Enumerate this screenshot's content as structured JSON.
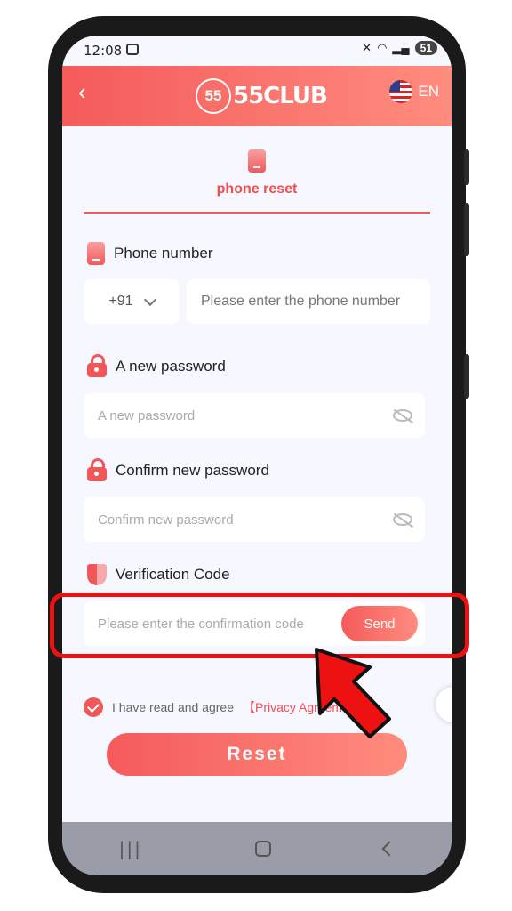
{
  "status": {
    "time": "12:08",
    "battery": "51"
  },
  "header": {
    "logo_badge": "55",
    "logo_text": "55CLUB",
    "lang": "EN"
  },
  "tab": {
    "label": "phone reset"
  },
  "phone": {
    "label": "Phone number",
    "country_code": "+91",
    "placeholder": "Please enter the phone number"
  },
  "new_password": {
    "label": "A new password",
    "placeholder": "A new password"
  },
  "confirm_password": {
    "label": "Confirm new password",
    "placeholder": "Confirm new password"
  },
  "verification": {
    "label": "Verification Code",
    "placeholder": "Please enter the confirmation code",
    "send_label": "Send"
  },
  "agreement": {
    "text": "I have read and agree",
    "link": "【Privacy Agreeme"
  },
  "reset_label": "Reset",
  "colors": {
    "accent": "#f45b5b",
    "accent_light": "#ff8c7e",
    "annotation": "#ee1111"
  },
  "icons": [
    "back-icon",
    "flag-icon",
    "phone-icon",
    "lock-icon",
    "shield-icon",
    "eye-off-icon",
    "check-icon",
    "arrow-annotation-icon"
  ]
}
